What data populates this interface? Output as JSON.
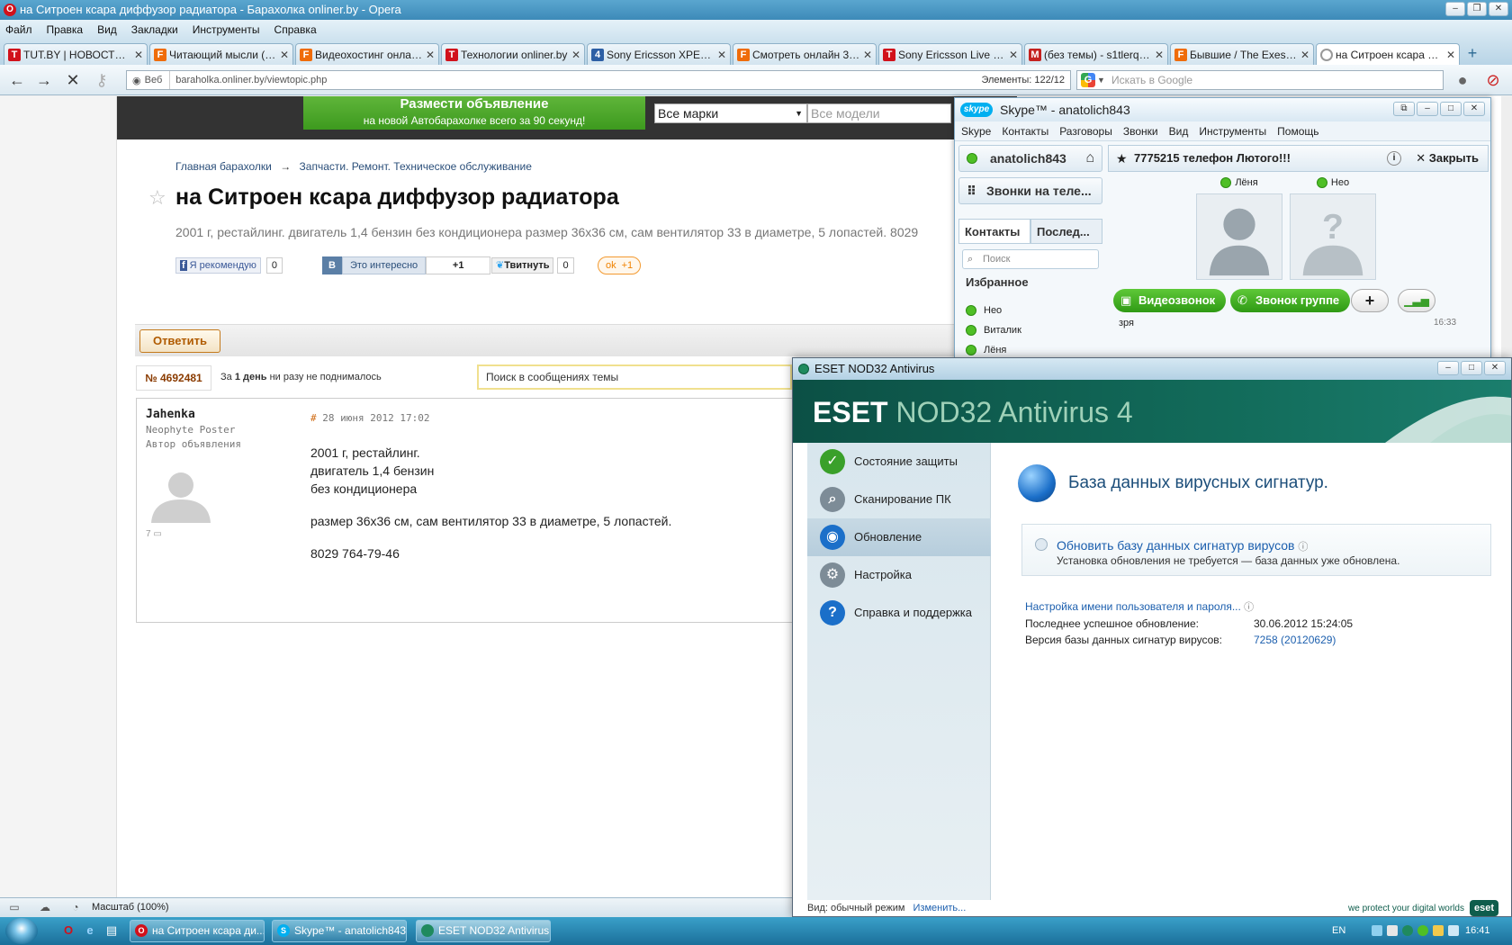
{
  "browser": {
    "title": "на Ситроен ксара диффузор радиатора - Барахолка onliner.by - Opera",
    "menu": [
      "Файл",
      "Правка",
      "Вид",
      "Закладки",
      "Инструменты",
      "Справка"
    ],
    "tabs": [
      {
        "label": "TUT.BY | НОВОСТИ - ...",
        "icon_color": "#d1111b",
        "icon_char": "T"
      },
      {
        "label": "Читающий мысли (Се...",
        "icon_color": "#ef6c0a",
        "icon_char": "F"
      },
      {
        "label": "Видеохостинг онлайн...",
        "icon_color": "#ef6c0a",
        "icon_char": "F"
      },
      {
        "label": "Технологии onliner.by",
        "icon_color": "#d1111b",
        "icon_char": "T"
      },
      {
        "label": "Sony Ericsson XPERIA ...",
        "icon_color": "#2d5fa5",
        "icon_char": "4"
      },
      {
        "label": "Смотреть онлайн 3 в ...",
        "icon_color": "#ef6c0a",
        "icon_char": "F"
      },
      {
        "label": "Sony Ericsson Live wit...",
        "icon_color": "#d1111b",
        "icon_char": "T"
      },
      {
        "label": "(без темы) - s1tlerq3...",
        "icon_color": "#c5221f",
        "icon_char": "M"
      },
      {
        "label": "Бывшие / The Exes (C...",
        "icon_color": "#ef6c0a",
        "icon_char": "F"
      },
      {
        "label": "на Ситроен ксара ди...",
        "icon_color": "#999999",
        "icon_char": "",
        "active": true
      }
    ],
    "address": {
      "web_label": "Веб",
      "url": "baraholka.onliner.by/viewtopic.php",
      "elements": "Элементы:   122/12"
    },
    "search_placeholder": "Искать в Google",
    "status": {
      "zoom": "Масштаб (100%)"
    }
  },
  "page": {
    "banner": {
      "title": "Размести объявление",
      "subtitle": "на новой Автобарахолке всего за 90 секунд!"
    },
    "selects": {
      "make": "Все марки",
      "model": "Все модели"
    },
    "breadcrumb": {
      "home": "Главная барахолки",
      "arrow": "→",
      "section": "Запчасти. Ремонт. Техническое обслуживание"
    },
    "title": "на Ситроен ксара диффузор радиатора",
    "summary": "2001 г, рестайлинг. двигатель 1,4 бензин без кондиционера размер 36х36 см, сам вентилятор 33 в диаметре, 5 лопастей. 8029",
    "share": {
      "fb_label": "Я рекомендую",
      "fb_count": "0",
      "vk_label": "Это интересно",
      "vk_count": "+1",
      "tw_label": "Твитнуть",
      "tw_count": "0",
      "ok_count": "+1"
    },
    "reply_label": "Ответить",
    "topic_number": "№ 4692481",
    "views": {
      "prefix": "За ",
      "bold": "1 день",
      "suffix": " ни разу не поднималось"
    },
    "search_topic": "Поиск в сообщениях темы",
    "post": {
      "author": "Jahenka",
      "rank": "Neophyte Poster",
      "role": "Автор объявления",
      "count": "7",
      "date_hash": "#",
      "date": "28 июня 2012 17:02",
      "lines": [
        "2001 г, рестайлинг.",
        "двигатель 1,4 бензин",
        "без кондиционера",
        "размер 36х36 см, сам вентилятор 33 в диаметре, 5 лопастей.",
        "8029 764-79-46"
      ]
    }
  },
  "skype": {
    "title": "Skype™ - anatolich843",
    "logo": "skype",
    "menu": [
      "Skype",
      "Контакты",
      "Разговоры",
      "Звонки",
      "Вид",
      "Инструменты",
      "Помощь"
    ],
    "user": "anatolich843",
    "calls_label": "Звонки на теле...",
    "tabs": [
      "Контакты",
      "Послед..."
    ],
    "search": "Поиск",
    "favorites_label": "Избранное",
    "contacts": [
      "Нео",
      "Виталик",
      "Лёня"
    ],
    "chat_title": "7775215 телефон Лютого!!!",
    "close_label": "Закрыть",
    "participants": [
      "Лёня",
      "Нео"
    ],
    "video_call": "Видеозвонок",
    "group_call": "Звонок группе",
    "message": {
      "text": "зря",
      "time": "16:33"
    }
  },
  "eset": {
    "title": "ESET NOD32 Antivirus",
    "brand": {
      "strong": "ESET",
      "light": "NOD32 Antivirus 4"
    },
    "nav": [
      {
        "label": "Состояние защиты",
        "icon": "check-icon",
        "color": "#3aa02a"
      },
      {
        "label": "Сканирование ПК",
        "icon": "magnifier-icon",
        "color": "#7d8c97"
      },
      {
        "label": "Обновление",
        "icon": "globe-icon",
        "color": "#1b6fc9",
        "active": true
      },
      {
        "label": "Настройка",
        "icon": "gear-icon",
        "color": "#7d8c97"
      },
      {
        "label": "Справка и поддержка",
        "icon": "help-icon",
        "color": "#1b6fc9"
      }
    ],
    "heading": "База данных вирусных сигнатур.",
    "update_link": "Обновить базу данных сигнатур вирусов",
    "update_status": "Установка обновления не требуется — база данных уже обновлена.",
    "credentials_link": "Настройка имени пользователя и пароля...",
    "last_update_label": "Последнее успешное обновление:",
    "last_update_value": "30.06.2012 15:24:05",
    "db_version_label": "Версия базы данных сигнатур вирусов:",
    "db_version_value": "7258 (20120629)",
    "footer_view": "Вид: обычный режим",
    "footer_change": "Изменить...",
    "tagline": "we protect your digital worlds",
    "logo_badge": "eset"
  },
  "taskbar": {
    "tasks": [
      {
        "label": "на Ситроен ксара ди...",
        "icon_color": "#d1111b",
        "icon_char": "O"
      },
      {
        "label": "Skype™ - anatolich843",
        "icon_color": "#00aff0",
        "icon_char": "S"
      },
      {
        "label": "ESET NOD32 Antivirus",
        "icon_color": "#1f8a5e",
        "icon_char": ""
      }
    ],
    "lang": "EN",
    "clock": "16:41"
  }
}
